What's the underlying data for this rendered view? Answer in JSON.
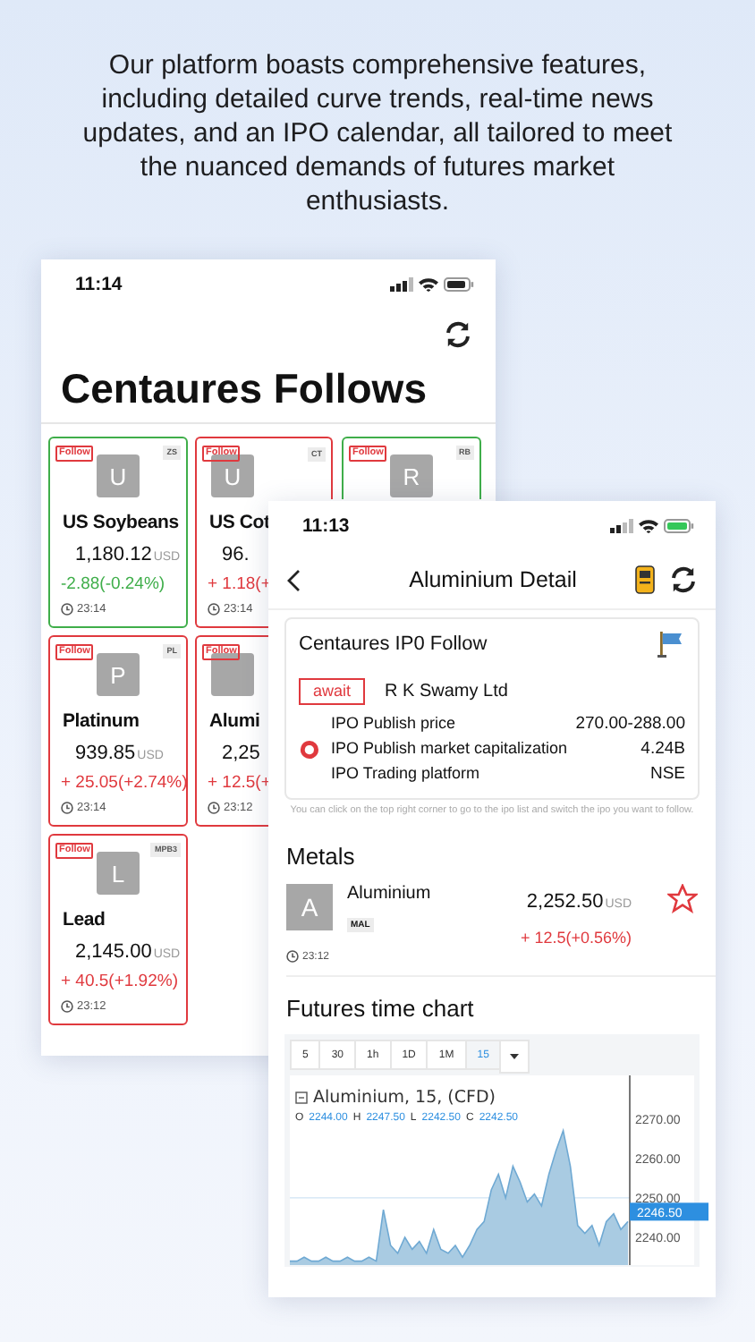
{
  "headline": "Our platform boasts comprehensive features, including detailed curve trends, real-time news updates, and an IPO calendar, all tailored to meet the nuanced demands of futures market enthusiasts.",
  "follows_screen": {
    "time": "11:14",
    "title": "Centaures Follows",
    "card_rows": [
      [
        {
          "color": "#3fae4a",
          "tag": "Follow",
          "code": "ZS",
          "avatar": "U",
          "name": "US Soybeans",
          "price": "1,180.12",
          "currency": "USD",
          "change": "-2.88(-0.24%)",
          "updated": "23:14"
        },
        {
          "color": "#e0393e",
          "tag": "Follow",
          "code": "CT",
          "avatar": "U",
          "name": "US Cot",
          "price": "96.",
          "change": "+ 1.18(+",
          "updated": "23:14"
        },
        {
          "color": "#3fae4a",
          "tag": "Follow",
          "code": "RB",
          "avatar": "R"
        }
      ],
      [
        {
          "color": "#e0393e",
          "tag": "Follow",
          "code": "PL",
          "avatar": "P",
          "name": "Platinum",
          "price": "939.85",
          "currency": "USD",
          "change": "+ 25.05(+2.74%)",
          "updated": "23:14"
        },
        {
          "color": "#e0393e",
          "tag": "Follow",
          "name": "Alumi",
          "price": "2,25",
          "change": "+ 12.5(+",
          "updated": "23:12"
        }
      ],
      [
        {
          "color": "#e0393e",
          "tag": "Follow",
          "code": "MPB3",
          "avatar": "L",
          "name": "Lead",
          "price": "2,145.00",
          "currency": "USD",
          "change": "+ 40.5(+1.92%)",
          "updated": "23:12"
        }
      ]
    ]
  },
  "detail_screen": {
    "time": "11:13",
    "title": "Aluminium Detail",
    "ipo": {
      "title": "Centaures IP0 Follow",
      "status": "await",
      "company": "R K Swamy Ltd",
      "rows": [
        {
          "label": "IPO Publish price",
          "value": "270.00-288.00"
        },
        {
          "label": "IPO Publish market capitalization",
          "value": "4.24B"
        },
        {
          "label": "IPO Trading platform",
          "value": "NSE"
        }
      ]
    },
    "hint": "You can click on the top right corner to go to the ipo list and switch the ipo you want to follow.",
    "section": "Metals",
    "instrument": {
      "avatar": "A",
      "name": "Aluminium",
      "code": "MAL",
      "price": "2,252.50",
      "currency": "USD",
      "change": "+ 12.5(+0.56%)",
      "updated": "23:12",
      "favorite": false
    },
    "chart_title": "Futures time chart",
    "intervals": [
      {
        "label": "5",
        "selected": false
      },
      {
        "label": "30",
        "selected": false
      },
      {
        "label": "1h",
        "selected": false
      },
      {
        "label": "1D",
        "selected": false
      },
      {
        "label": "1M",
        "selected": false
      },
      {
        "label": "15",
        "selected": true
      }
    ],
    "legend": "Aluminium, 15, (CFD)",
    "ohlc": [
      {
        "label": "O",
        "value": "2244.00"
      },
      {
        "label": "H",
        "value": "2247.50"
      },
      {
        "label": "L",
        "value": "2242.50"
      },
      {
        "label": "C",
        "value": "2242.50"
      }
    ],
    "last_price": "2246.50",
    "chart_data": {
      "type": "area",
      "ylim": [
        2233,
        2281
      ],
      "yticks": [
        {
          "value": 2270,
          "label": "2270.00"
        },
        {
          "value": 2260,
          "label": "2260.00"
        },
        {
          "value": 2250,
          "label": "2250.00"
        },
        {
          "value": 2240,
          "label": "2240.00"
        }
      ],
      "values": [
        2234,
        2234,
        2235,
        2234,
        2234,
        2235,
        2234,
        2234,
        2235,
        2234,
        2234,
        2235,
        2234,
        2247,
        2238,
        2236,
        2240,
        2237,
        2239,
        2236,
        2242,
        2237,
        2236,
        2238,
        2235,
        2238,
        2242,
        2244,
        2252,
        2256,
        2250,
        2258,
        2254,
        2249,
        2251,
        2248,
        2256,
        2262,
        2267,
        2258,
        2243,
        2241,
        2243,
        2238,
        2244,
        2246,
        2242,
        2244
      ]
    }
  }
}
